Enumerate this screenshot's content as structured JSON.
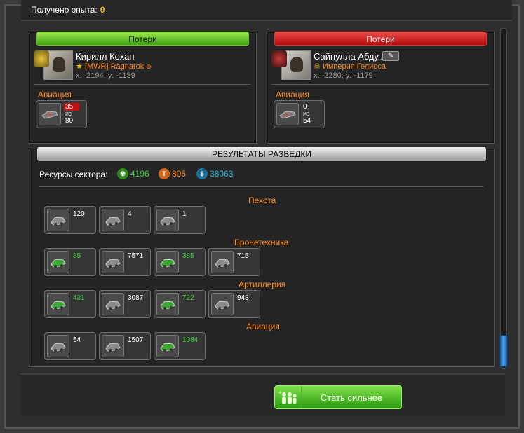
{
  "header": {
    "exp_label": "Получено опыта:",
    "exp_value": "0"
  },
  "left": {
    "loss_header": "Потери",
    "player": {
      "name": "Кирилл Кохан",
      "alliance": "[MWR] Ragnarok",
      "coords": "x: -2194; y: -1139"
    },
    "section": "Авиация",
    "unit": {
      "lost": "35",
      "of": "из",
      "total": "80"
    }
  },
  "right": {
    "loss_header": "Потери",
    "player": {
      "name": "Сайпулла Абду...",
      "alliance": "Империя Гелиоса",
      "coords": "x: -2280; y: -1179"
    },
    "section": "Авиация",
    "unit": {
      "lost": "0",
      "of": "из",
      "total": "54"
    }
  },
  "intel": {
    "title": "РЕЗУЛЬТАТЫ РАЗВЕДКИ",
    "resources_label": "Ресурсы сектора:",
    "resources": [
      {
        "icon": "radiation-icon",
        "value": "4196",
        "color": "#3ed13e"
      },
      {
        "icon": "titanium-icon",
        "value": "805",
        "color": "#ff8a1a"
      },
      {
        "icon": "credits-icon",
        "value": "38063",
        "color": "#2fb8d8"
      }
    ],
    "categories": [
      {
        "label": "Пехота",
        "units": [
          {
            "value": "120",
            "color": "w"
          },
          {
            "value": "4",
            "color": "w"
          },
          {
            "value": "1",
            "color": "w"
          }
        ]
      },
      {
        "label": "Бронетехника",
        "units": [
          {
            "value": "85",
            "color": "g"
          },
          {
            "value": "7571",
            "color": "w"
          },
          {
            "value": "385",
            "color": "g"
          },
          {
            "value": "715",
            "color": "w"
          }
        ]
      },
      {
        "label": "Артиллерия",
        "units": [
          {
            "value": "431",
            "color": "g"
          },
          {
            "value": "3087",
            "color": "w"
          },
          {
            "value": "722",
            "color": "g"
          },
          {
            "value": "943",
            "color": "w"
          }
        ]
      },
      {
        "label": "Авиация",
        "units": [
          {
            "value": "54",
            "color": "w"
          },
          {
            "value": "1507",
            "color": "w"
          },
          {
            "value": "1084",
            "color": "g"
          }
        ]
      }
    ]
  },
  "footer": {
    "button_label": "Стать сильнее"
  }
}
